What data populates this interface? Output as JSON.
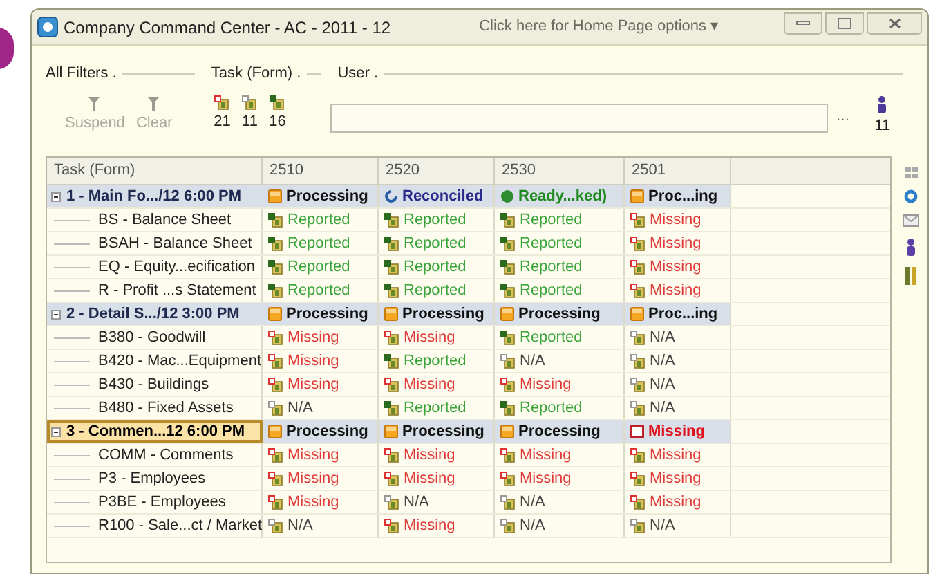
{
  "window": {
    "title": "Company Command Center - AC - 2011 - 12",
    "home_link": "Click here for Home Page options ▾"
  },
  "filters": [
    {
      "label": "All Filters ."
    },
    {
      "label": "Task (Form) ."
    },
    {
      "label": "User ."
    }
  ],
  "toolbar": {
    "buttons": [
      {
        "label": "Suspend",
        "disabled": true
      },
      {
        "label": "Clear",
        "disabled": true
      }
    ],
    "form_counts": [
      {
        "kind": "missing",
        "count": "21"
      },
      {
        "kind": "na",
        "count": "11"
      },
      {
        "kind": "reported",
        "count": "16"
      }
    ],
    "browse_button": "…",
    "user_count": "11"
  },
  "table": {
    "columns": [
      "Task (Form)",
      "2510",
      "2520",
      "2530",
      "2501"
    ],
    "rows": [
      {
        "kind": "group",
        "expanded": true,
        "selected": false,
        "cells": [
          {
            "text": "1 - Main Fo.../12 6:00 PM"
          },
          {
            "kind": "processing",
            "text": "Processing"
          },
          {
            "kind": "reconciled",
            "text": "Reconciled"
          },
          {
            "kind": "ready",
            "text": "Ready...ked)"
          },
          {
            "kind": "processing",
            "text": "Proc...ing"
          }
        ]
      },
      {
        "kind": "item",
        "cells": [
          {
            "text": "BS - Balance Sheet"
          },
          {
            "kind": "reported",
            "text": "Reported"
          },
          {
            "kind": "reported",
            "text": "Reported"
          },
          {
            "kind": "reported",
            "text": "Reported"
          },
          {
            "kind": "missing",
            "text": "Missing"
          }
        ]
      },
      {
        "kind": "item",
        "cells": [
          {
            "text": "BSAH - Balance Sheet"
          },
          {
            "kind": "reported",
            "text": "Reported"
          },
          {
            "kind": "reported",
            "text": "Reported"
          },
          {
            "kind": "reported",
            "text": "Reported"
          },
          {
            "kind": "missing",
            "text": "Missing"
          }
        ]
      },
      {
        "kind": "item",
        "cells": [
          {
            "text": "EQ - Equity...ecification"
          },
          {
            "kind": "reported",
            "text": "Reported"
          },
          {
            "kind": "reported",
            "text": "Reported"
          },
          {
            "kind": "reported",
            "text": "Reported"
          },
          {
            "kind": "missing",
            "text": "Missing"
          }
        ]
      },
      {
        "kind": "item",
        "cells": [
          {
            "text": "R - Profit ...s Statement"
          },
          {
            "kind": "reported",
            "text": "Reported"
          },
          {
            "kind": "reported",
            "text": "Reported"
          },
          {
            "kind": "reported",
            "text": "Reported"
          },
          {
            "kind": "missing",
            "text": "Missing"
          }
        ]
      },
      {
        "kind": "group",
        "expanded": true,
        "selected": false,
        "cells": [
          {
            "text": "2 - Detail S.../12 3:00 PM"
          },
          {
            "kind": "processing",
            "text": "Processing"
          },
          {
            "kind": "processing",
            "text": "Processing"
          },
          {
            "kind": "processing",
            "text": "Processing"
          },
          {
            "kind": "processing",
            "text": "Proc...ing"
          }
        ]
      },
      {
        "kind": "item",
        "cells": [
          {
            "text": "B380 - Goodwill"
          },
          {
            "kind": "missing",
            "text": "Missing"
          },
          {
            "kind": "missing",
            "text": "Missing"
          },
          {
            "kind": "reported",
            "text": "Reported"
          },
          {
            "kind": "na",
            "text": "N/A"
          }
        ]
      },
      {
        "kind": "item",
        "cells": [
          {
            "text": "B420 - Mac...Equipment"
          },
          {
            "kind": "missing",
            "text": "Missing"
          },
          {
            "kind": "reported",
            "text": "Reported"
          },
          {
            "kind": "na",
            "text": "N/A"
          },
          {
            "kind": "na",
            "text": "N/A"
          }
        ]
      },
      {
        "kind": "item",
        "cells": [
          {
            "text": "B430 - Buildings"
          },
          {
            "kind": "missing",
            "text": "Missing"
          },
          {
            "kind": "missing",
            "text": "Missing"
          },
          {
            "kind": "missing",
            "text": "Missing"
          },
          {
            "kind": "na",
            "text": "N/A"
          }
        ]
      },
      {
        "kind": "item",
        "cells": [
          {
            "text": "B480 - Fixed Assets"
          },
          {
            "kind": "na",
            "text": "N/A"
          },
          {
            "kind": "reported",
            "text": "Reported"
          },
          {
            "kind": "reported",
            "text": "Reported"
          },
          {
            "kind": "na",
            "text": "N/A"
          }
        ]
      },
      {
        "kind": "group",
        "expanded": true,
        "selected": true,
        "cells": [
          {
            "text": "3 - Commen...12 6:00 PM"
          },
          {
            "kind": "processing",
            "text": "Processing"
          },
          {
            "kind": "processing",
            "text": "Processing"
          },
          {
            "kind": "processing",
            "text": "Processing"
          },
          {
            "kind": "alert",
            "text": "Missing"
          }
        ]
      },
      {
        "kind": "item",
        "cells": [
          {
            "text": "COMM - Comments"
          },
          {
            "kind": "missing",
            "text": "Missing"
          },
          {
            "kind": "missing",
            "text": "Missing"
          },
          {
            "kind": "missing",
            "text": "Missing"
          },
          {
            "kind": "missing",
            "text": "Missing"
          }
        ]
      },
      {
        "kind": "item",
        "cells": [
          {
            "text": "P3 - Employees"
          },
          {
            "kind": "missing",
            "text": "Missing"
          },
          {
            "kind": "missing",
            "text": "Missing"
          },
          {
            "kind": "missing",
            "text": "Missing"
          },
          {
            "kind": "missing",
            "text": "Missing"
          }
        ]
      },
      {
        "kind": "item",
        "cells": [
          {
            "text": "P3BE - Employees"
          },
          {
            "kind": "missing",
            "text": "Missing"
          },
          {
            "kind": "na",
            "text": "N/A"
          },
          {
            "kind": "na",
            "text": "N/A"
          },
          {
            "kind": "missing",
            "text": "Missing"
          }
        ]
      },
      {
        "kind": "item",
        "cells": [
          {
            "text": "R100 - Sale...ct / Market"
          },
          {
            "kind": "na",
            "text": "N/A"
          },
          {
            "kind": "missing",
            "text": "Missing"
          },
          {
            "kind": "na",
            "text": "N/A"
          },
          {
            "kind": "na",
            "text": "N/A"
          }
        ]
      }
    ]
  }
}
